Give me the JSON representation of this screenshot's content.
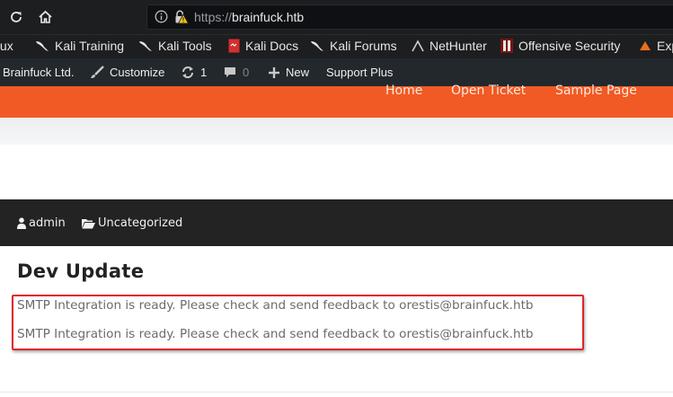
{
  "browser": {
    "url_scheme": "https://",
    "url_host": "brainfuck.htb"
  },
  "bookmarks": [
    {
      "label": "Kali Linux"
    },
    {
      "label": "Kali Training"
    },
    {
      "label": "Kali Tools"
    },
    {
      "label": "Kali Docs"
    },
    {
      "label": "Kali Forums"
    },
    {
      "label": "NetHunter"
    },
    {
      "label": "Offensive Security"
    },
    {
      "label": "Exploit-DB"
    }
  ],
  "adminbar": {
    "site_name": "Brainfuck Ltd.",
    "customize": "Customize",
    "updates_count": "1",
    "comments_count": "0",
    "new_label": "New",
    "support": "Support Plus"
  },
  "site_menu": {
    "items": [
      "Home",
      "Open Ticket",
      "Sample Page"
    ]
  },
  "post": {
    "author": "admin",
    "category": "Uncategorized",
    "title": "Dev Update",
    "lines": [
      "SMTP Integration is ready. Please check and send feedback to orestis@brainfuck.htb",
      "SMTP Integration is ready. Please check and send feedback to orestis@brainfuck.htb"
    ]
  },
  "colors": {
    "nav_orange": "#f15a24",
    "highlight_red": "#e0262a",
    "toolbar_dark": "#1d1e20"
  }
}
